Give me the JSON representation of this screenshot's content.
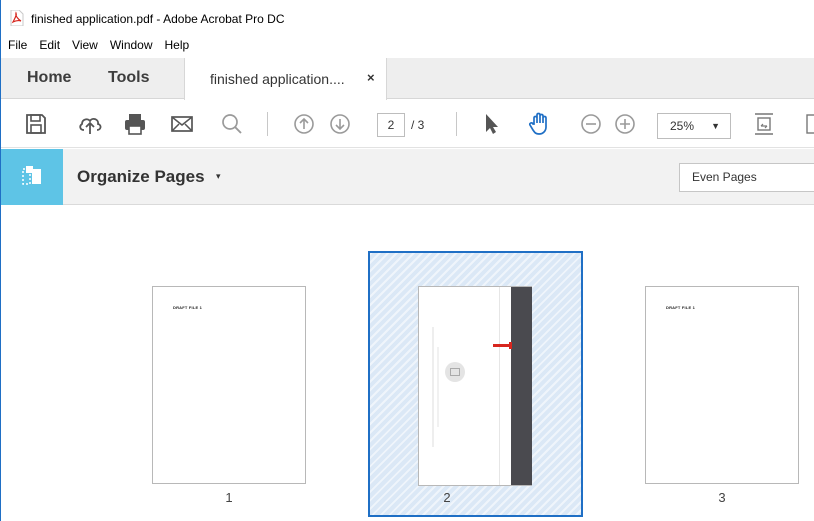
{
  "window": {
    "title": "finished application.pdf - Adobe Acrobat Pro DC"
  },
  "menu": [
    "File",
    "Edit",
    "View",
    "Window",
    "Help"
  ],
  "tabs": {
    "home": "Home",
    "tools": "Tools",
    "document": "finished application....",
    "close_glyph": "×"
  },
  "toolbar": {
    "icons": [
      "save-icon",
      "cloud-upload-icon",
      "print-icon",
      "email-icon",
      "search-icon",
      "previous-page-icon",
      "next-page-icon",
      "select-arrow-icon",
      "hand-tool-icon",
      "zoom-out-icon",
      "zoom-in-icon",
      "fit-page-icon"
    ],
    "current_page": "2",
    "page_total": "/ 3",
    "zoom": "25%",
    "zoom_arrow": "▼"
  },
  "organize": {
    "title": "Organize Pages",
    "caret": "▾",
    "filter_value": "Even Pages"
  },
  "pages": [
    {
      "number": "1",
      "selected": false,
      "header_text": "DRAFT FILE 1"
    },
    {
      "number": "2",
      "selected": true
    },
    {
      "number": "3",
      "selected": false,
      "header_text": "DRAFT FILE 1"
    }
  ],
  "colors": {
    "accent": "#1f6fc5",
    "organize_icon_bg": "#5ec4e6",
    "selection_fill": "#dbe8f6",
    "pdf_icon_red": "#d7261e"
  }
}
